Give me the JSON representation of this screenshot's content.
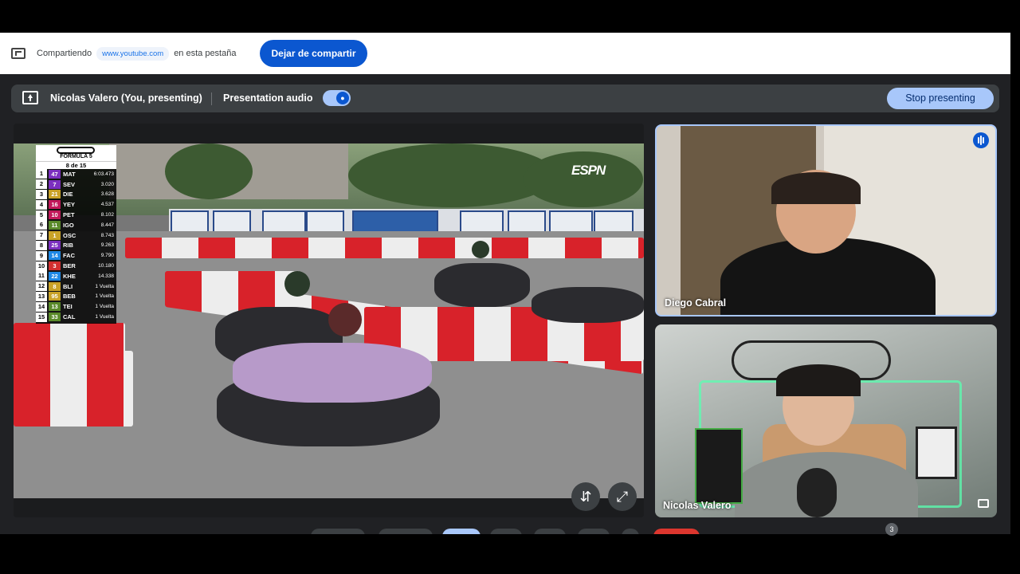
{
  "share_bar": {
    "prefix": "Compartiendo",
    "url": "www.youtube.com",
    "suffix": "en esta pestaña",
    "stop_button": "Dejar de compartir"
  },
  "presentation_bar": {
    "presenter": "Nicolas Valero (You, presenting)",
    "audio_label": "Presentation audio",
    "audio_enabled": true,
    "stop_button": "Stop presenting"
  },
  "video": {
    "channel_logo": "ESPN",
    "standings": {
      "series": "FÓRMULA 5",
      "round": "8 de 15",
      "rows": [
        {
          "pos": "1",
          "num": "47",
          "code": "MAT",
          "gap": "6:03.473",
          "color": "#7b2fbf"
        },
        {
          "pos": "2",
          "num": "7",
          "code": "SEV",
          "gap": "3.020",
          "color": "#7b2fbf"
        },
        {
          "pos": "3",
          "num": "21",
          "code": "DIE",
          "gap": "3.628",
          "color": "#c9a227"
        },
        {
          "pos": "4",
          "num": "16",
          "code": "YEY",
          "gap": "4.537",
          "color": "#c2185b"
        },
        {
          "pos": "5",
          "num": "10",
          "code": "PET",
          "gap": "8.102",
          "color": "#c2185b"
        },
        {
          "pos": "6",
          "num": "11",
          "code": "IGO",
          "gap": "8.447",
          "color": "#5a8a2a"
        },
        {
          "pos": "7",
          "num": "1",
          "code": "OSC",
          "gap": "8.743",
          "color": "#c9a227"
        },
        {
          "pos": "8",
          "num": "25",
          "code": "RIB",
          "gap": "9.263",
          "color": "#7b2fbf"
        },
        {
          "pos": "9",
          "num": "14",
          "code": "FAC",
          "gap": "9.790",
          "color": "#1e88e5"
        },
        {
          "pos": "10",
          "num": "3",
          "code": "BER",
          "gap": "10.180",
          "color": "#d32f2f"
        },
        {
          "pos": "11",
          "num": "22",
          "code": "KHE",
          "gap": "14.338",
          "color": "#1e88e5"
        },
        {
          "pos": "12",
          "num": "8",
          "code": "BLI",
          "gap": "1 Vuelta",
          "color": "#c9a227"
        },
        {
          "pos": "13",
          "num": "95",
          "code": "BEB",
          "gap": "1 Vuelta",
          "color": "#c9a227"
        },
        {
          "pos": "14",
          "num": "13",
          "code": "TEI",
          "gap": "1 Vuelta",
          "color": "#5a8a2a"
        },
        {
          "pos": "15",
          "num": "33",
          "code": "CAL",
          "gap": "1 Vuelta",
          "color": "#5a8a2a"
        }
      ]
    },
    "swap_icon": "swap-vertical-icon",
    "fullscreen_icon": "fullscreen-icon"
  },
  "participants": [
    {
      "name": "Diego Cabral",
      "speaking": true
    },
    {
      "name": "Nicolas Valero",
      "speaking": false
    }
  ],
  "people_count": "3",
  "colors": {
    "accent": "#0b57d0",
    "accent_light": "#a8c7fa",
    "meet_bg": "#202124",
    "bar_bg": "#3c4043"
  }
}
